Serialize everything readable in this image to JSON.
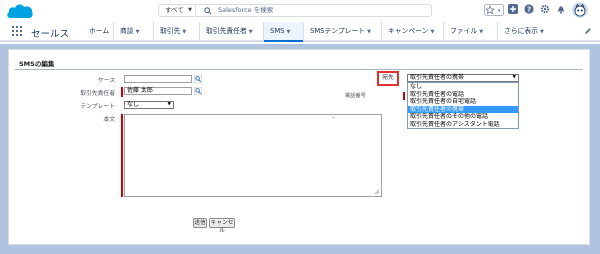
{
  "header": {
    "search_scope": "すべて",
    "search_placeholder": "Salesforce を検索"
  },
  "nav": {
    "app_name": "セールス",
    "tabs": [
      {
        "label": "ホーム",
        "chevron": false
      },
      {
        "label": "商談",
        "chevron": true
      },
      {
        "label": "取引先",
        "chevron": true
      },
      {
        "label": "取引先責任者",
        "chevron": true
      },
      {
        "label": "SMS",
        "chevron": true,
        "active": true
      },
      {
        "label": "SMSテンプレート",
        "chevron": true
      },
      {
        "label": "キャンペーン",
        "chevron": true
      },
      {
        "label": "ファイル",
        "chevron": true
      },
      {
        "label": "さらに表示",
        "chevron": true
      }
    ]
  },
  "form": {
    "title": "SMSの編集",
    "case_label": "ケース",
    "case_value": "",
    "contact_label": "取引先責任者",
    "contact_value": "佐藤 太郎",
    "template_label": "テンプレート",
    "template_value": "なし",
    "body_label": "本文",
    "body_value": "",
    "phone_label": "電話番号",
    "to_label": "宛先",
    "to_selected": "取引先責任者の携帯",
    "to_options": [
      "なし",
      "取引先責任者の電話",
      "取引先責任者の自宅電話",
      "取引先責任者の携帯",
      "取引先責任者のその他の電話",
      "取引先責任者のアシスタント電話"
    ],
    "to_highlighted_index": 3,
    "send_label": "送信",
    "cancel_label": "キャンセル"
  },
  "colors": {
    "brand": "#0070d2",
    "page_bg": "#b0c4df",
    "required": "#cc0000",
    "highlight_box": "#e0312c",
    "option_highlight": "#3399ff"
  }
}
